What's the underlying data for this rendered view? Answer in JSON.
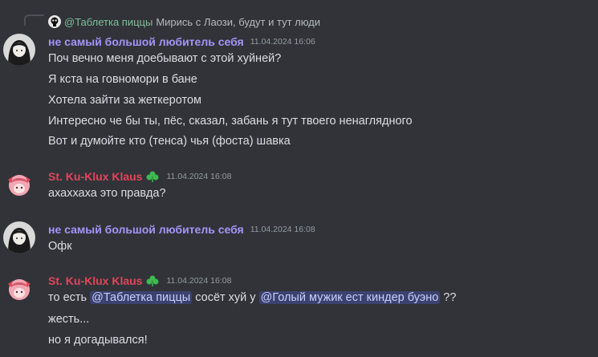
{
  "reply": {
    "mention": "@Таблетка пиццы",
    "text": "Мирись с Лаози, будут и тут люди",
    "avatar_icon": "skull-avatar-icon"
  },
  "groups": [
    {
      "author": "не самый большой любитель себя",
      "timestamp": "11.04.2024 16:06",
      "color": "#a594f9",
      "lines": [
        "Поч вечно меня доебывают с этой хуйней?",
        "Я кста на говномори в бане",
        "Хотела зайти за жеткеротом",
        "Интересно че бы ты, пёс, сказал, забань я тут твоего ненаглядного",
        "Вот и думойте кто (тенса) чья (фоста) шавка"
      ]
    },
    {
      "author": "St. Ku-Klux Klaus",
      "timestamp": "11.04.2024 16:08",
      "color": "#e0465a",
      "role_icon": "green-leaf-role-icon",
      "lines": [
        "ахаххаха это правда?"
      ]
    },
    {
      "author": "не самый большой любитель себя",
      "timestamp": "11.04.2024 16:08",
      "color": "#a594f9",
      "lines": [
        "Офк"
      ]
    },
    {
      "author": "St. Ku-Klux Klaus",
      "timestamp": "11.04.2024 16:08",
      "color": "#e0465a",
      "role_icon": "green-leaf-role-icon",
      "mention_line": {
        "prefix": "то есть ",
        "mention1": "@Таблетка пиццы",
        "middle": " сосёт хуй у ",
        "mention2": "@Голый мужик ест киндер буэно",
        "suffix": " ??"
      },
      "lines": [
        "жесть...",
        "но я догадывался!"
      ]
    }
  ]
}
